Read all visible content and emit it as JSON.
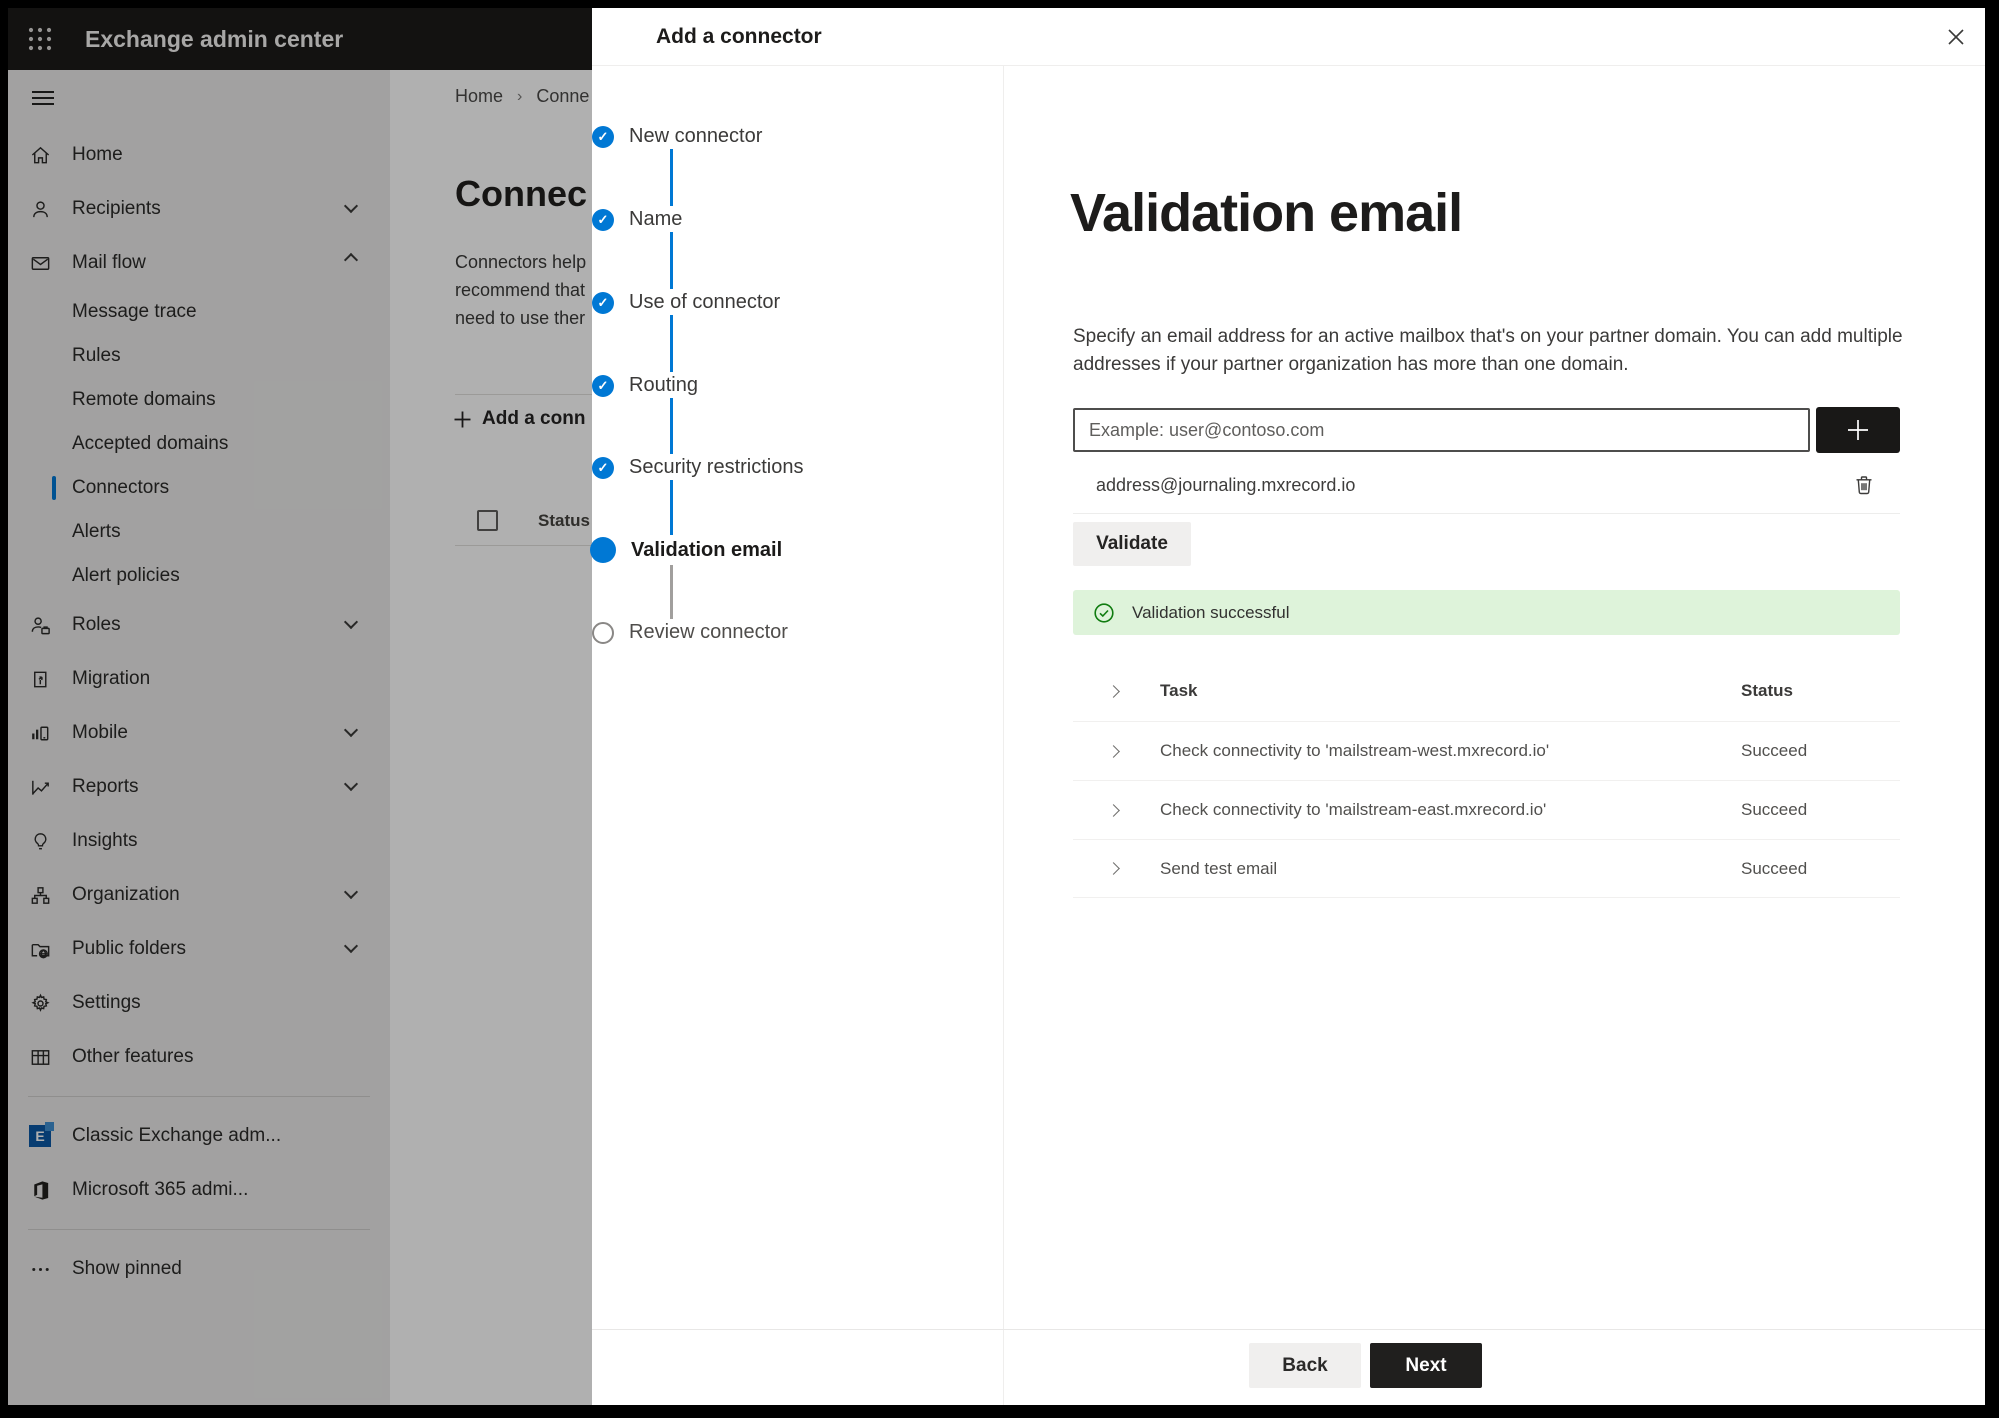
{
  "topbar": {
    "app_title": "Exchange admin center"
  },
  "sidebar": {
    "items": [
      "Home",
      "Recipients",
      "Mail flow",
      "Message trace",
      "Rules",
      "Remote domains",
      "Accepted domains",
      "Connectors",
      "Alerts",
      "Alert policies",
      "Roles",
      "Migration",
      "Mobile",
      "Reports",
      "Insights",
      "Organization",
      "Public folders",
      "Settings",
      "Other features",
      "Classic Exchange adm...",
      "Microsoft 365 admi...",
      "Show pinned"
    ]
  },
  "background": {
    "breadcrumb": {
      "home": "Home",
      "separator": "›",
      "current": "Conne"
    },
    "heading": "Connec",
    "para_line1": "Connectors help",
    "para_line2": "recommend that",
    "para_line3": "need to use ther",
    "add_button": "Add a conn",
    "status_header": "Status"
  },
  "panel": {
    "title": "Add a connector",
    "steps": [
      {
        "label": "New connector",
        "state": "done"
      },
      {
        "label": "Name",
        "state": "done"
      },
      {
        "label": "Use of connector",
        "state": "done"
      },
      {
        "label": "Routing",
        "state": "done"
      },
      {
        "label": "Security restrictions",
        "state": "done"
      },
      {
        "label": "Validation email",
        "state": "current"
      },
      {
        "label": "Review connector",
        "state": "todo"
      }
    ],
    "check_glyph": "✓",
    "main": {
      "title": "Validation email",
      "description": "Specify an email address for an active mailbox that's on your partner domain. You can add multiple addresses if your partner organization has more than one domain.",
      "email_input_placeholder": "Example: user@contoso.com",
      "added_address": "address@journaling.mxrecord.io",
      "validate_button": "Validate",
      "success_message": "Validation successful",
      "table": {
        "columns": [
          "Task",
          "Status"
        ],
        "rows": [
          {
            "task": "Check connectivity to 'mailstream-west.mxrecord.io'",
            "status": "Succeed"
          },
          {
            "task": "Check connectivity to 'mailstream-east.mxrecord.io'",
            "status": "Succeed"
          },
          {
            "task": "Send test email",
            "status": "Succeed"
          }
        ]
      }
    },
    "footer": {
      "back": "Back",
      "next": "Next"
    }
  },
  "colors": {
    "accent": "#0078d4",
    "success_bg": "#def3da",
    "success_icon": "#107c10",
    "topbar_bg": "#1c1b1a"
  }
}
